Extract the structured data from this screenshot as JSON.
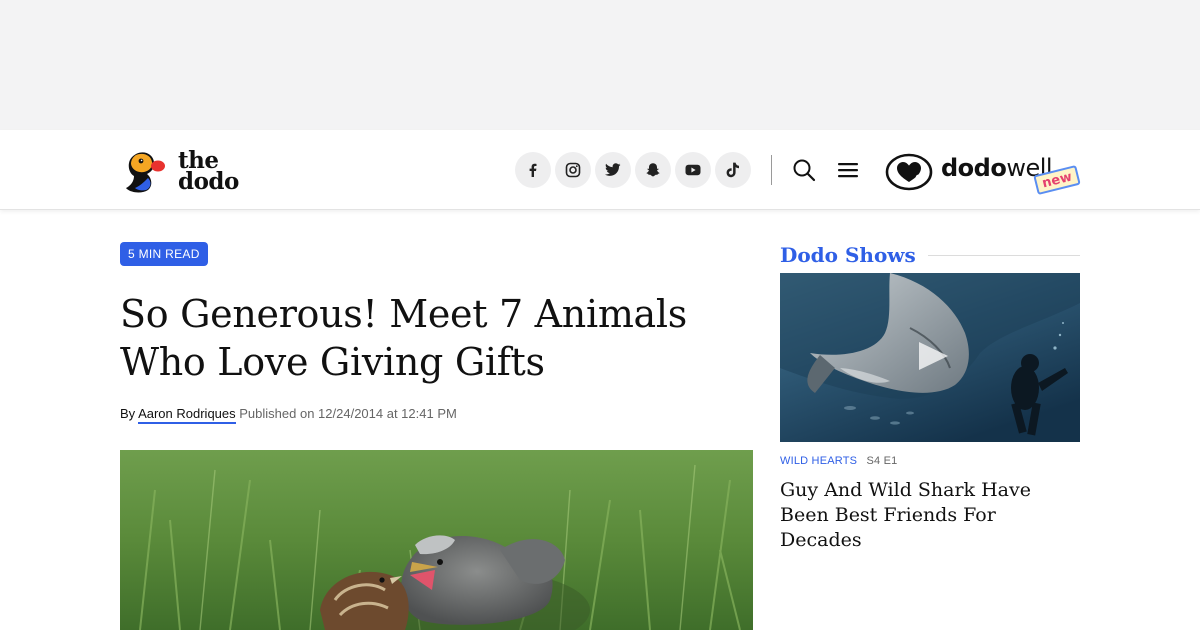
{
  "header": {
    "logo_line1": "the",
    "logo_line2": "dodo",
    "social_icons": [
      "facebook-icon",
      "instagram-icon",
      "twitter-icon",
      "snapchat-icon",
      "youtube-icon",
      "tiktok-icon"
    ],
    "dodowell_bold": "dodo",
    "dodowell_light": "well",
    "dodowell_badge": "new"
  },
  "article": {
    "read_time": "5 MIN READ",
    "headline_line1": "So Generous! Meet 7 Animals",
    "headline_line2": "Who Love Giving Gifts",
    "by_label": "By",
    "author": "Aaron Rodriques",
    "published": "Published on 12/24/2014 at 12:41 PM"
  },
  "sidebar": {
    "heading": "Dodo Shows",
    "show_name": "WILD HEARTS",
    "episode": "S4 E1",
    "video_title": "Guy And Wild Shark Have Been Best Friends For Decades"
  },
  "colors": {
    "accent_blue": "#2f5fe6",
    "ad_background": "#f3f3f4",
    "social_bg": "#eeeeef"
  }
}
